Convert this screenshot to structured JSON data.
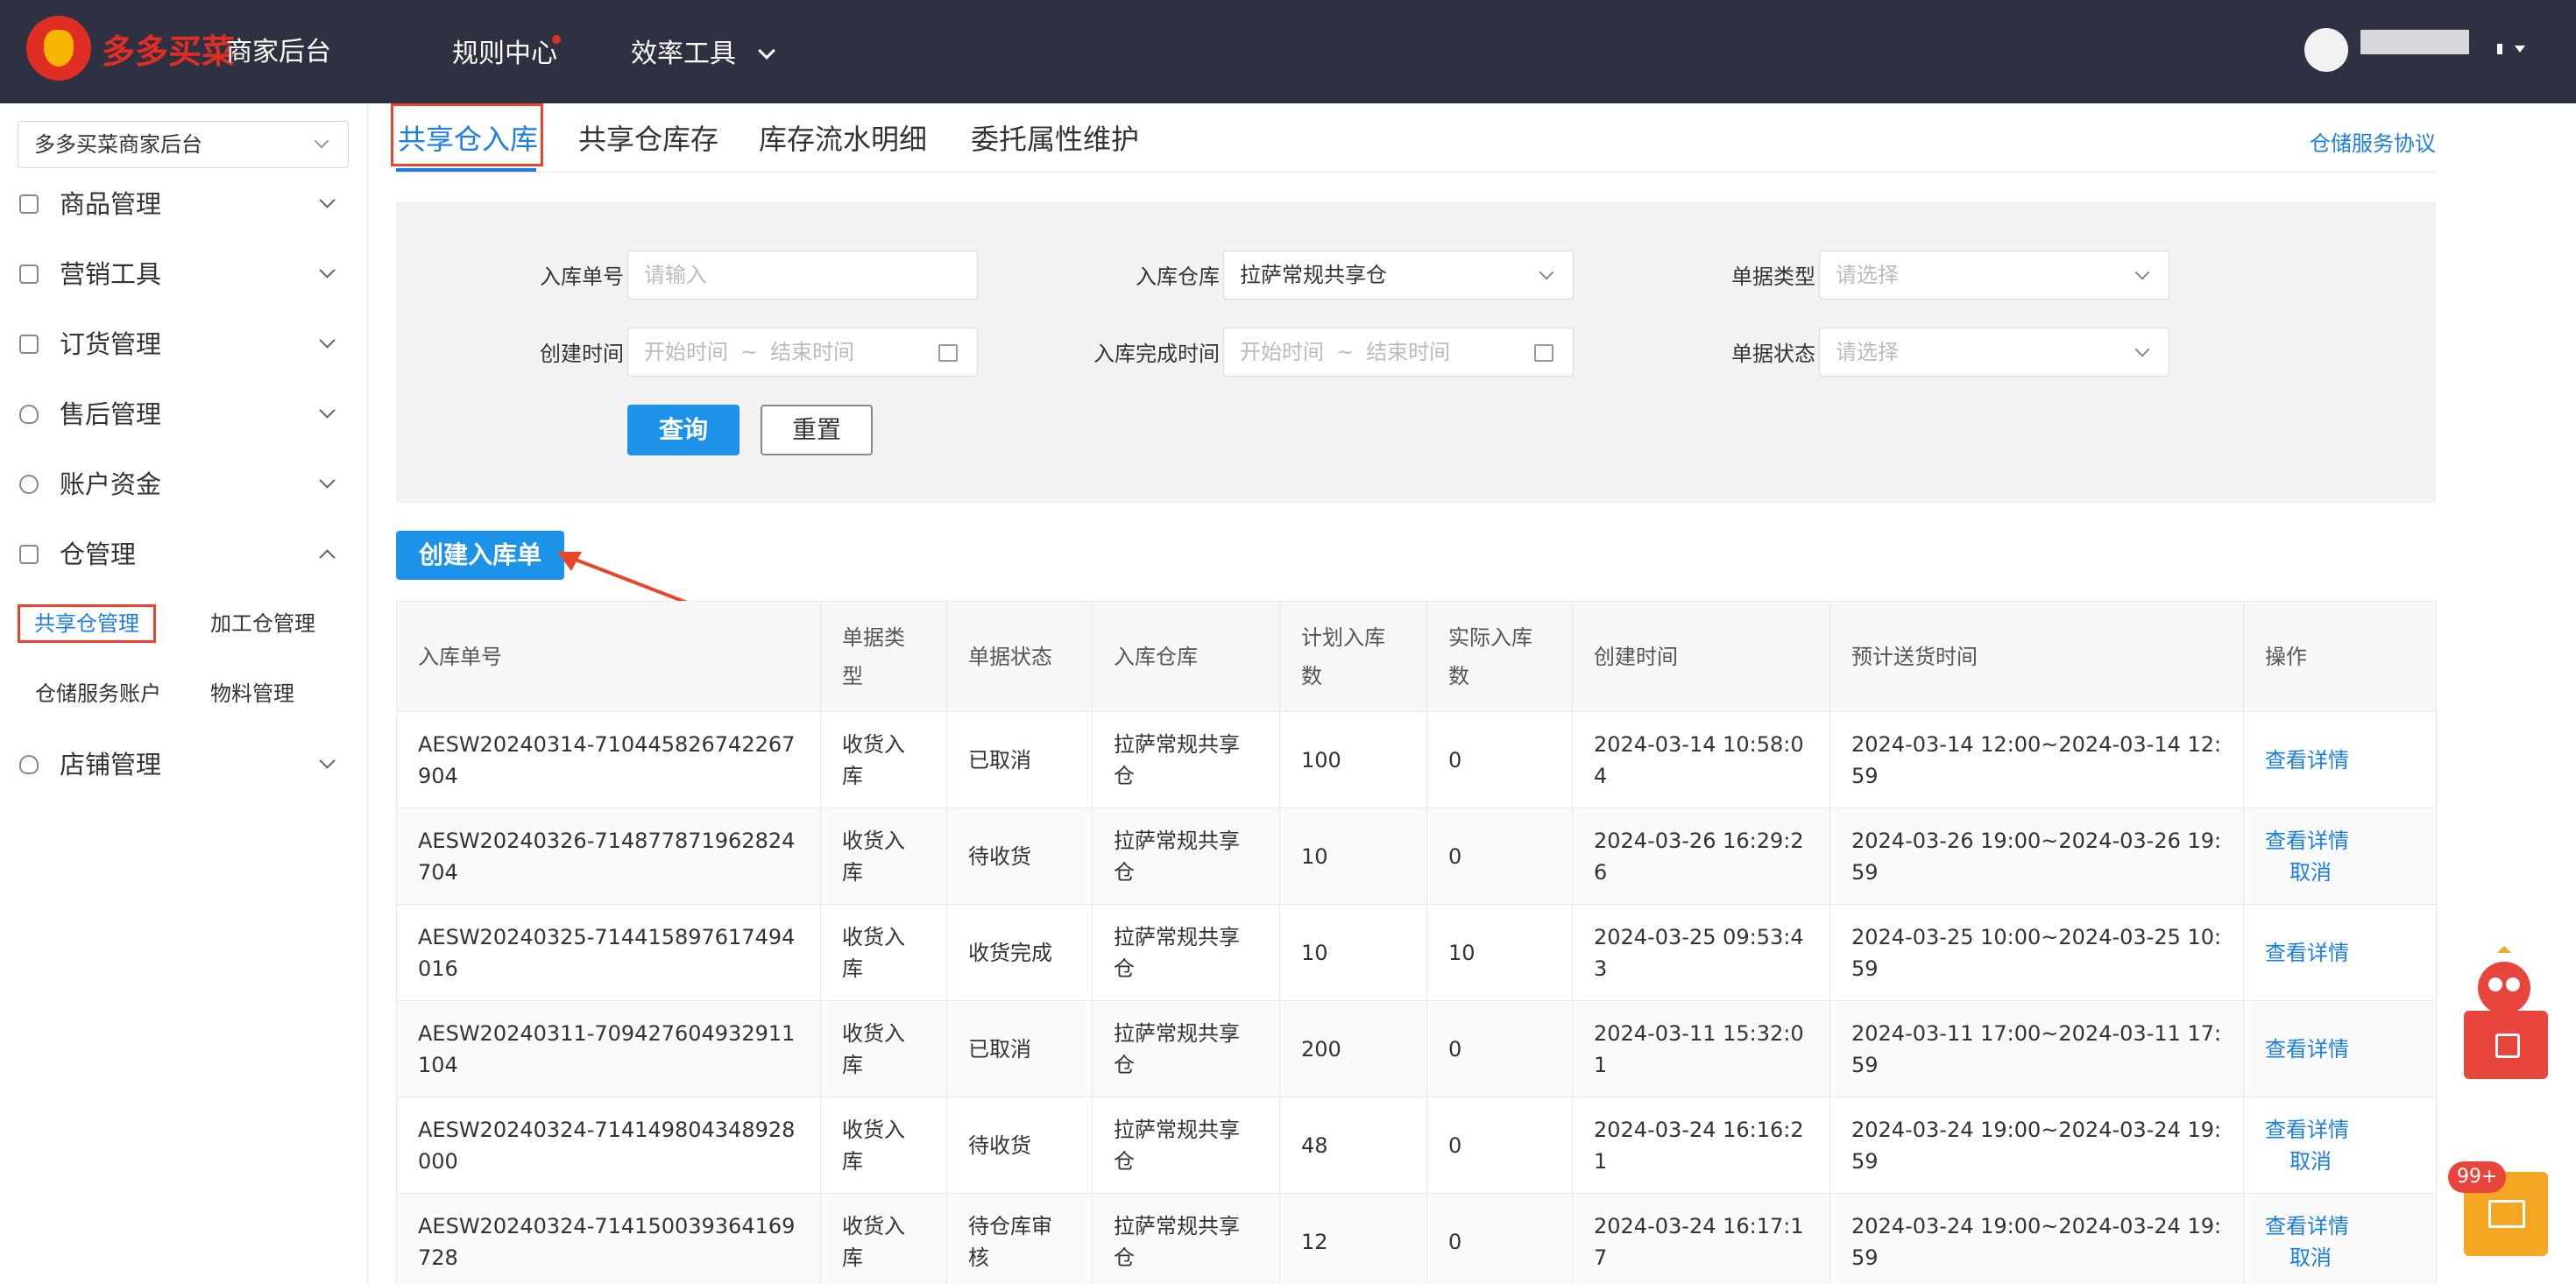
{
  "header": {
    "logo_text": "多多买菜",
    "logo_sub": "商家后台",
    "nav": [
      {
        "label": "规则中心"
      },
      {
        "label": "效率工具"
      }
    ]
  },
  "sidebar": {
    "shop_select": "多多买菜商家后台",
    "menu": [
      {
        "label": "商品管理",
        "icon": "bag-icon"
      },
      {
        "label": "营销工具",
        "icon": "gift-icon"
      },
      {
        "label": "订货管理",
        "icon": "list-icon"
      },
      {
        "label": "售后管理",
        "icon": "shield-check-icon"
      },
      {
        "label": "账户资金",
        "icon": "yen-icon"
      },
      {
        "label": "仓管理",
        "icon": "warehouse-icon"
      },
      {
        "label": "店铺管理",
        "icon": "store-icon"
      }
    ],
    "sub_items": [
      {
        "label": "共享仓管理"
      },
      {
        "label": "加工仓管理"
      },
      {
        "label": "仓储服务账户"
      },
      {
        "label": "物料管理"
      }
    ]
  },
  "tabs": [
    {
      "label": "共享仓入库"
    },
    {
      "label": "共享仓库存"
    },
    {
      "label": "库存流水明细"
    },
    {
      "label": "委托属性维护"
    }
  ],
  "tab_link": "仓储服务协议",
  "filters": {
    "order_no_label": "入库单号",
    "order_no_placeholder": "请输入",
    "warehouse_label": "入库仓库",
    "warehouse_value": "拉萨常规共享仓",
    "doc_type_label": "单据类型",
    "doc_type_placeholder": "请选择",
    "created_label": "创建时间",
    "completed_label": "入库完成时间",
    "start_placeholder": "开始时间",
    "end_placeholder": "结束时间",
    "range_sep": "~",
    "doc_status_label": "单据状态",
    "doc_status_placeholder": "请选择",
    "query_label": "查询",
    "reset_label": "重置"
  },
  "create_button": "创建入库单",
  "table": {
    "headers": [
      "入库单号",
      "单据类型",
      "单据状态",
      "入库仓库",
      "计划入库数",
      "实际入库数",
      "创建时间",
      "预计送货时间",
      "操作"
    ],
    "rows": [
      {
        "no": "AESW20240314-710445826742267904",
        "type": "收货入库",
        "status": "已取消",
        "warehouse": "拉萨常规共享仓",
        "plan": "100",
        "actual": "0",
        "created": "2024-03-14 10:58:04",
        "eta": "2024-03-14 12:00~2024-03-14 12:59",
        "ops": [
          "查看详情"
        ]
      },
      {
        "no": "AESW20240326-714877871962824704",
        "type": "收货入库",
        "status": "待收货",
        "warehouse": "拉萨常规共享仓",
        "plan": "10",
        "actual": "0",
        "created": "2024-03-26 16:29:26",
        "eta": "2024-03-26 19:00~2024-03-26 19:59",
        "ops": [
          "查看详情",
          "取消"
        ]
      },
      {
        "no": "AESW20240325-714415897617494016",
        "type": "收货入库",
        "status": "收货完成",
        "warehouse": "拉萨常规共享仓",
        "plan": "10",
        "actual": "10",
        "created": "2024-03-25 09:53:43",
        "eta": "2024-03-25 10:00~2024-03-25 10:59",
        "ops": [
          "查看详情"
        ]
      },
      {
        "no": "AESW20240311-709427604932911104",
        "type": "收货入库",
        "status": "已取消",
        "warehouse": "拉萨常规共享仓",
        "plan": "200",
        "actual": "0",
        "created": "2024-03-11 15:32:01",
        "eta": "2024-03-11 17:00~2024-03-11 17:59",
        "ops": [
          "查看详情"
        ]
      },
      {
        "no": "AESW20240324-714149804348928000",
        "type": "收货入库",
        "status": "待收货",
        "warehouse": "拉萨常规共享仓",
        "plan": "48",
        "actual": "0",
        "created": "2024-03-24 16:16:21",
        "eta": "2024-03-24 19:00~2024-03-24 19:59",
        "ops": [
          "查看详情",
          "取消"
        ]
      },
      {
        "no": "AESW20240324-714150039364169728",
        "type": "收货入库",
        "status": "待仓库审核",
        "warehouse": "拉萨常规共享仓",
        "plan": "12",
        "actual": "0",
        "created": "2024-03-24 16:17:17",
        "eta": "2024-03-24 19:00~2024-03-24 19:59",
        "ops": [
          "查看详情",
          "取消"
        ]
      }
    ]
  },
  "floating": {
    "badge": "99+"
  },
  "colors": {
    "accent": "#1c7de3",
    "primary_button": "#1c92e8",
    "header_bg": "#2e3141",
    "annotation": "#e8452b"
  }
}
